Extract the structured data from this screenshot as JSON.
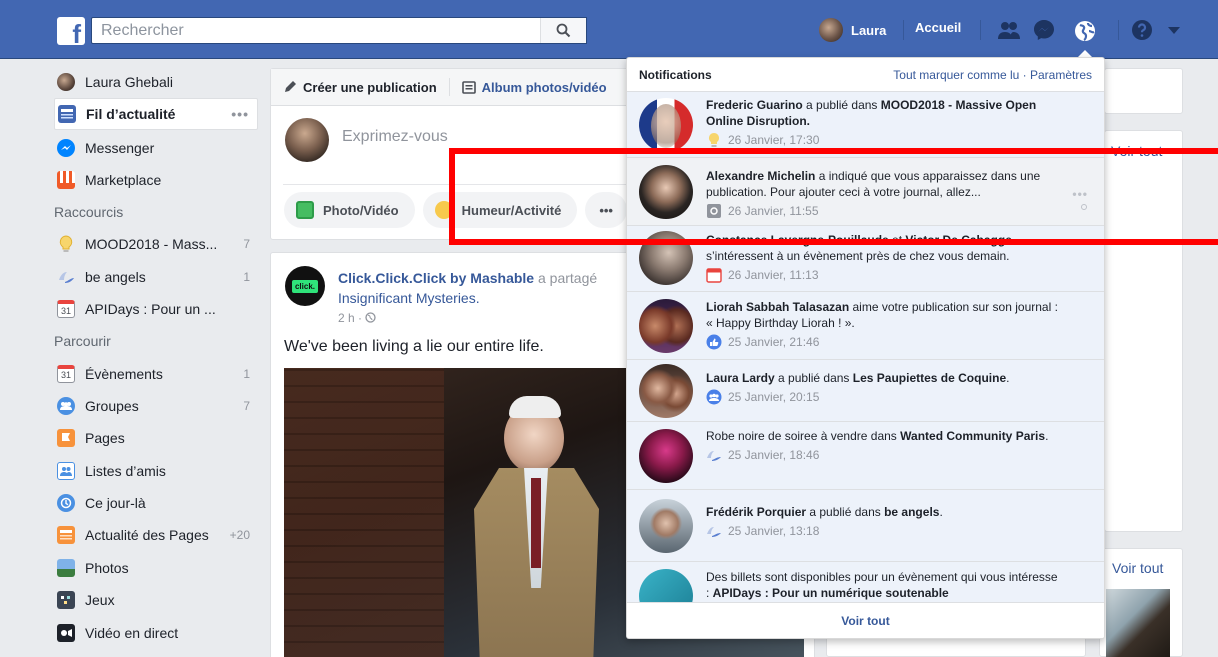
{
  "topbar": {
    "search_placeholder": "Rechercher",
    "user_name": "Laura",
    "home_label": "Accueil"
  },
  "icons": {
    "logo": "facebook-f-logo",
    "search": "search-icon",
    "friends": "friends-icon",
    "messenger": "messenger-icon",
    "notifications": "globe-icon",
    "help": "help-icon",
    "menu": "chevron-down-icon"
  },
  "colors": {
    "brand": "#4267b2",
    "link": "#365899",
    "highlight": "#ff0000",
    "unread_bg": "#edf2fa"
  },
  "left_nav": {
    "profile_name": "Laura Ghebali",
    "items": [
      {
        "label": "Fil d’actualité",
        "count": ""
      },
      {
        "label": "Messenger",
        "count": ""
      },
      {
        "label": "Marketplace",
        "count": ""
      }
    ],
    "shortcuts_heading": "Raccourcis",
    "shortcuts": [
      {
        "label": "MOOD2018 - Mass...",
        "count": "7"
      },
      {
        "label": "be angels",
        "count": "1"
      },
      {
        "label": "APIDays : Pour un ...",
        "count": ""
      }
    ],
    "explore_heading": "Parcourir",
    "explore": [
      {
        "label": "Évènements",
        "count": "1"
      },
      {
        "label": "Groupes",
        "count": "7"
      },
      {
        "label": "Pages",
        "count": ""
      },
      {
        "label": "Listes d’amis",
        "count": ""
      },
      {
        "label": "Ce jour-là",
        "count": ""
      },
      {
        "label": "Actualité des Pages",
        "count": "+20"
      },
      {
        "label": "Photos",
        "count": ""
      },
      {
        "label": "Jeux",
        "count": ""
      },
      {
        "label": "Vidéo en direct",
        "count": ""
      }
    ],
    "more_dots": "•••",
    "calendar_day": "31"
  },
  "composer": {
    "tab_create": "Créer une publication",
    "tab_album": "Album photos/vidéo",
    "placeholder": "Exprimez-vous",
    "action_photo": "Photo/Vidéo",
    "action_mood": "Humeur/Activité",
    "action_more": "•••"
  },
  "post": {
    "avatar_text": "click.",
    "page_name": "Click.Click.Click by Mashable",
    "action_text": "a partagé",
    "link_text": "Insignificant Mysteries.",
    "meta": "2 h · ",
    "text": "We've been living a lie our entire life."
  },
  "right": {
    "voir_tout_1": "Voir tout",
    "voir_tout_2": "Voir tout"
  },
  "notifications": {
    "title": "Notifications",
    "actions": "Tout marquer comme lu · Paramètres",
    "footer": "Voir tout",
    "items": [
      {
        "actor": "Frederic Guarino",
        "text": " a publié dans ",
        "target": "MOOD2018 - Massive Open Online Disruption.",
        "tail": "",
        "time": "26 Janvier, 17:30"
      },
      {
        "actor": "Alexandre Michelin",
        "text": " a indiqué que vous apparaissez dans une publication. Pour ajouter ceci à votre journal, allez...",
        "target": "",
        "tail": "",
        "time": "26 Janvier, 11:55"
      },
      {
        "actor": "Constance Lavergne-Pouillaude",
        "text": " et ",
        "target": "Victor De Cabagge",
        "tail": " s’intéressent à un évènement près de chez vous demain.",
        "time": "26 Janvier, 11:13"
      },
      {
        "actor": "Liorah Sabbah Talasazan",
        "text": " aime votre publication sur son journal : « Happy Birthday Liorah ! ».",
        "target": "",
        "tail": "",
        "time": "25 Janvier, 21:46"
      },
      {
        "actor": "Laura Lardy",
        "text": " a publié dans ",
        "target": "Les Paupiettes de Coquine",
        "tail": ".",
        "time": "25 Janvier, 20:15"
      },
      {
        "actor": "",
        "text": "Robe noire de soiree à vendre dans ",
        "target": "Wanted Community Paris",
        "tail": ".",
        "time": "25 Janvier, 18:46"
      },
      {
        "actor": "Frédérik Porquier",
        "text": " a publié dans ",
        "target": "be angels",
        "tail": ".",
        "time": "25 Janvier, 13:18"
      },
      {
        "actor": "",
        "text": "Des billets sont disponibles pour un évènement qui vous intéresse : ",
        "target": "APIDays : Pour un numérique soutenable",
        "tail": "",
        "time": ""
      }
    ],
    "item_more": "•••"
  }
}
